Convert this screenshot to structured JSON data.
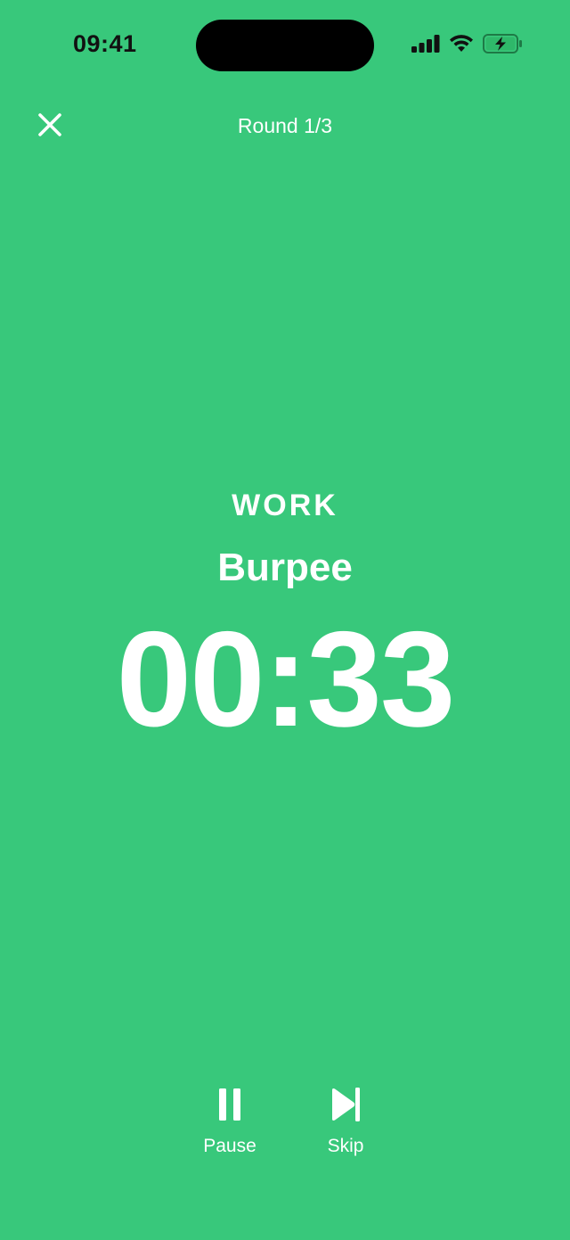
{
  "status_bar": {
    "time": "09:41"
  },
  "header": {
    "close_icon": "close-icon",
    "round": "Round 1/3"
  },
  "main": {
    "phase": "WORK",
    "exercise": "Burpee",
    "timer": "00:33"
  },
  "controls": {
    "pause_label": "Pause",
    "skip_label": "Skip",
    "pause_icon": "pause-icon",
    "skip_icon": "skip-icon"
  },
  "colors": {
    "background": "#38C87B",
    "text": "#FFFFFF"
  }
}
